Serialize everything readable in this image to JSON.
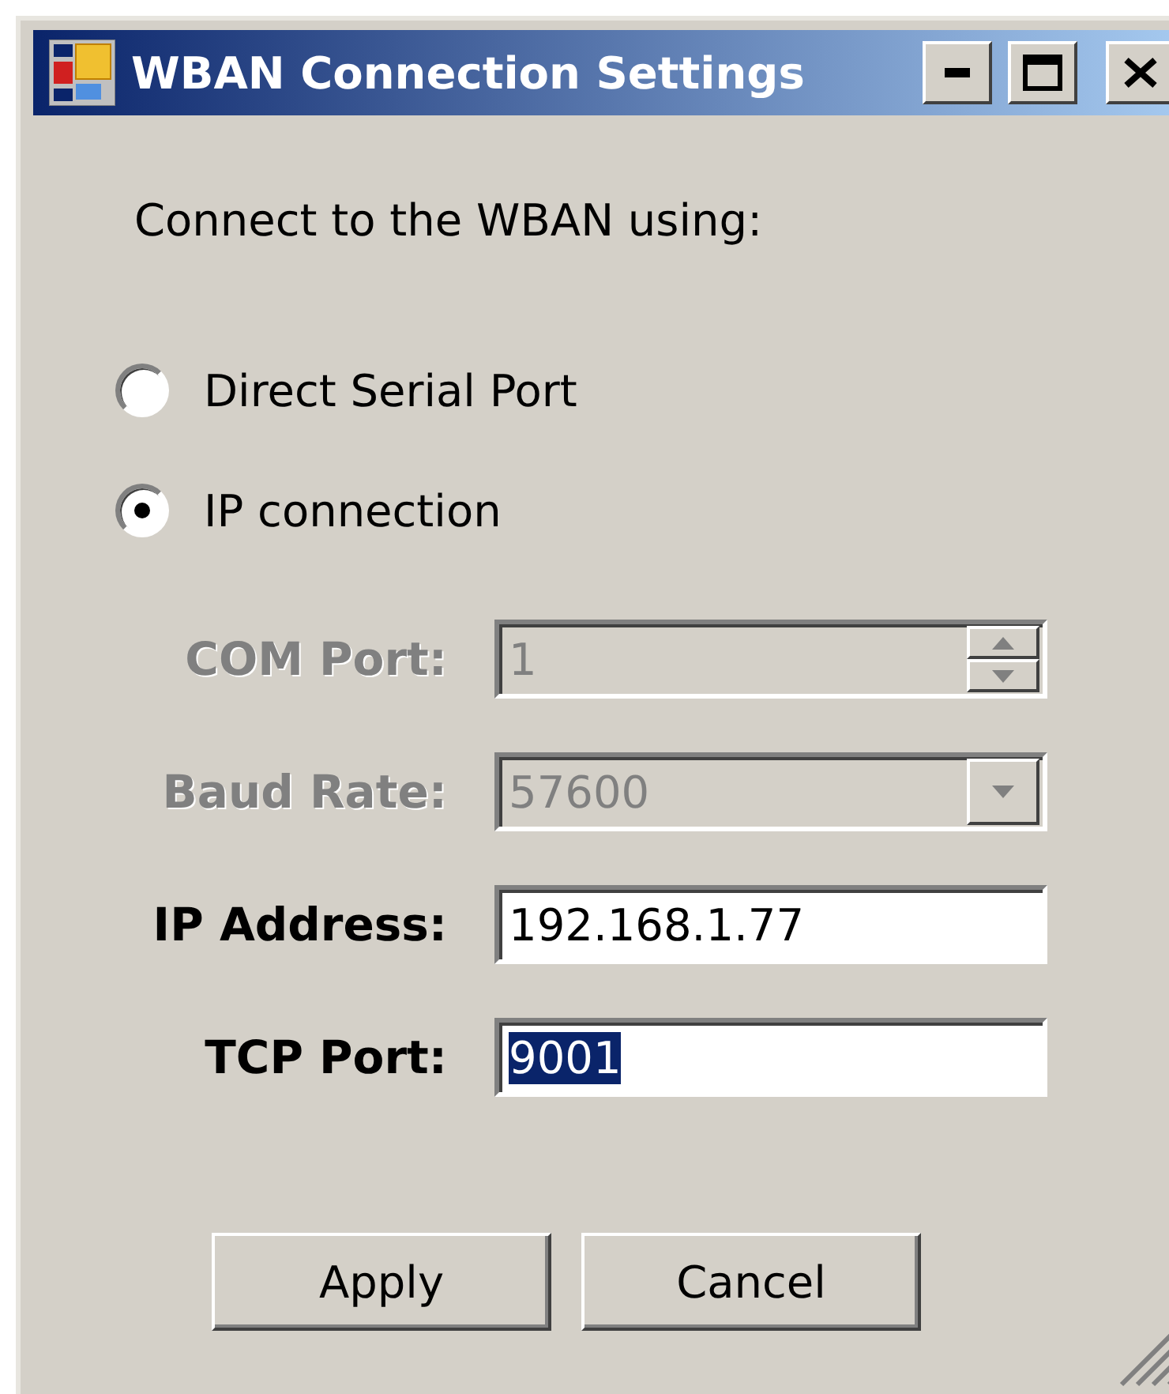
{
  "window": {
    "title": "WBAN Connection Settings"
  },
  "prompt": "Connect to the WBAN using:",
  "options": [
    {
      "label": "Direct Serial Port",
      "selected": false
    },
    {
      "label": "IP connection",
      "selected": true
    }
  ],
  "fields": [
    {
      "kind": "spinner",
      "label": "COM Port:",
      "value": "1",
      "disabled": true,
      "highlighted": false
    },
    {
      "kind": "dropdown",
      "label": "Baud Rate:",
      "value": "57600",
      "disabled": true,
      "highlighted": false
    },
    {
      "kind": "text",
      "label": "IP Address:",
      "value": "192.168.1.77",
      "disabled": false,
      "highlighted": false
    },
    {
      "kind": "text",
      "label": "TCP Port:",
      "value": "9001",
      "disabled": false,
      "highlighted": true
    }
  ],
  "buttons": [
    "Apply",
    "Cancel"
  ]
}
